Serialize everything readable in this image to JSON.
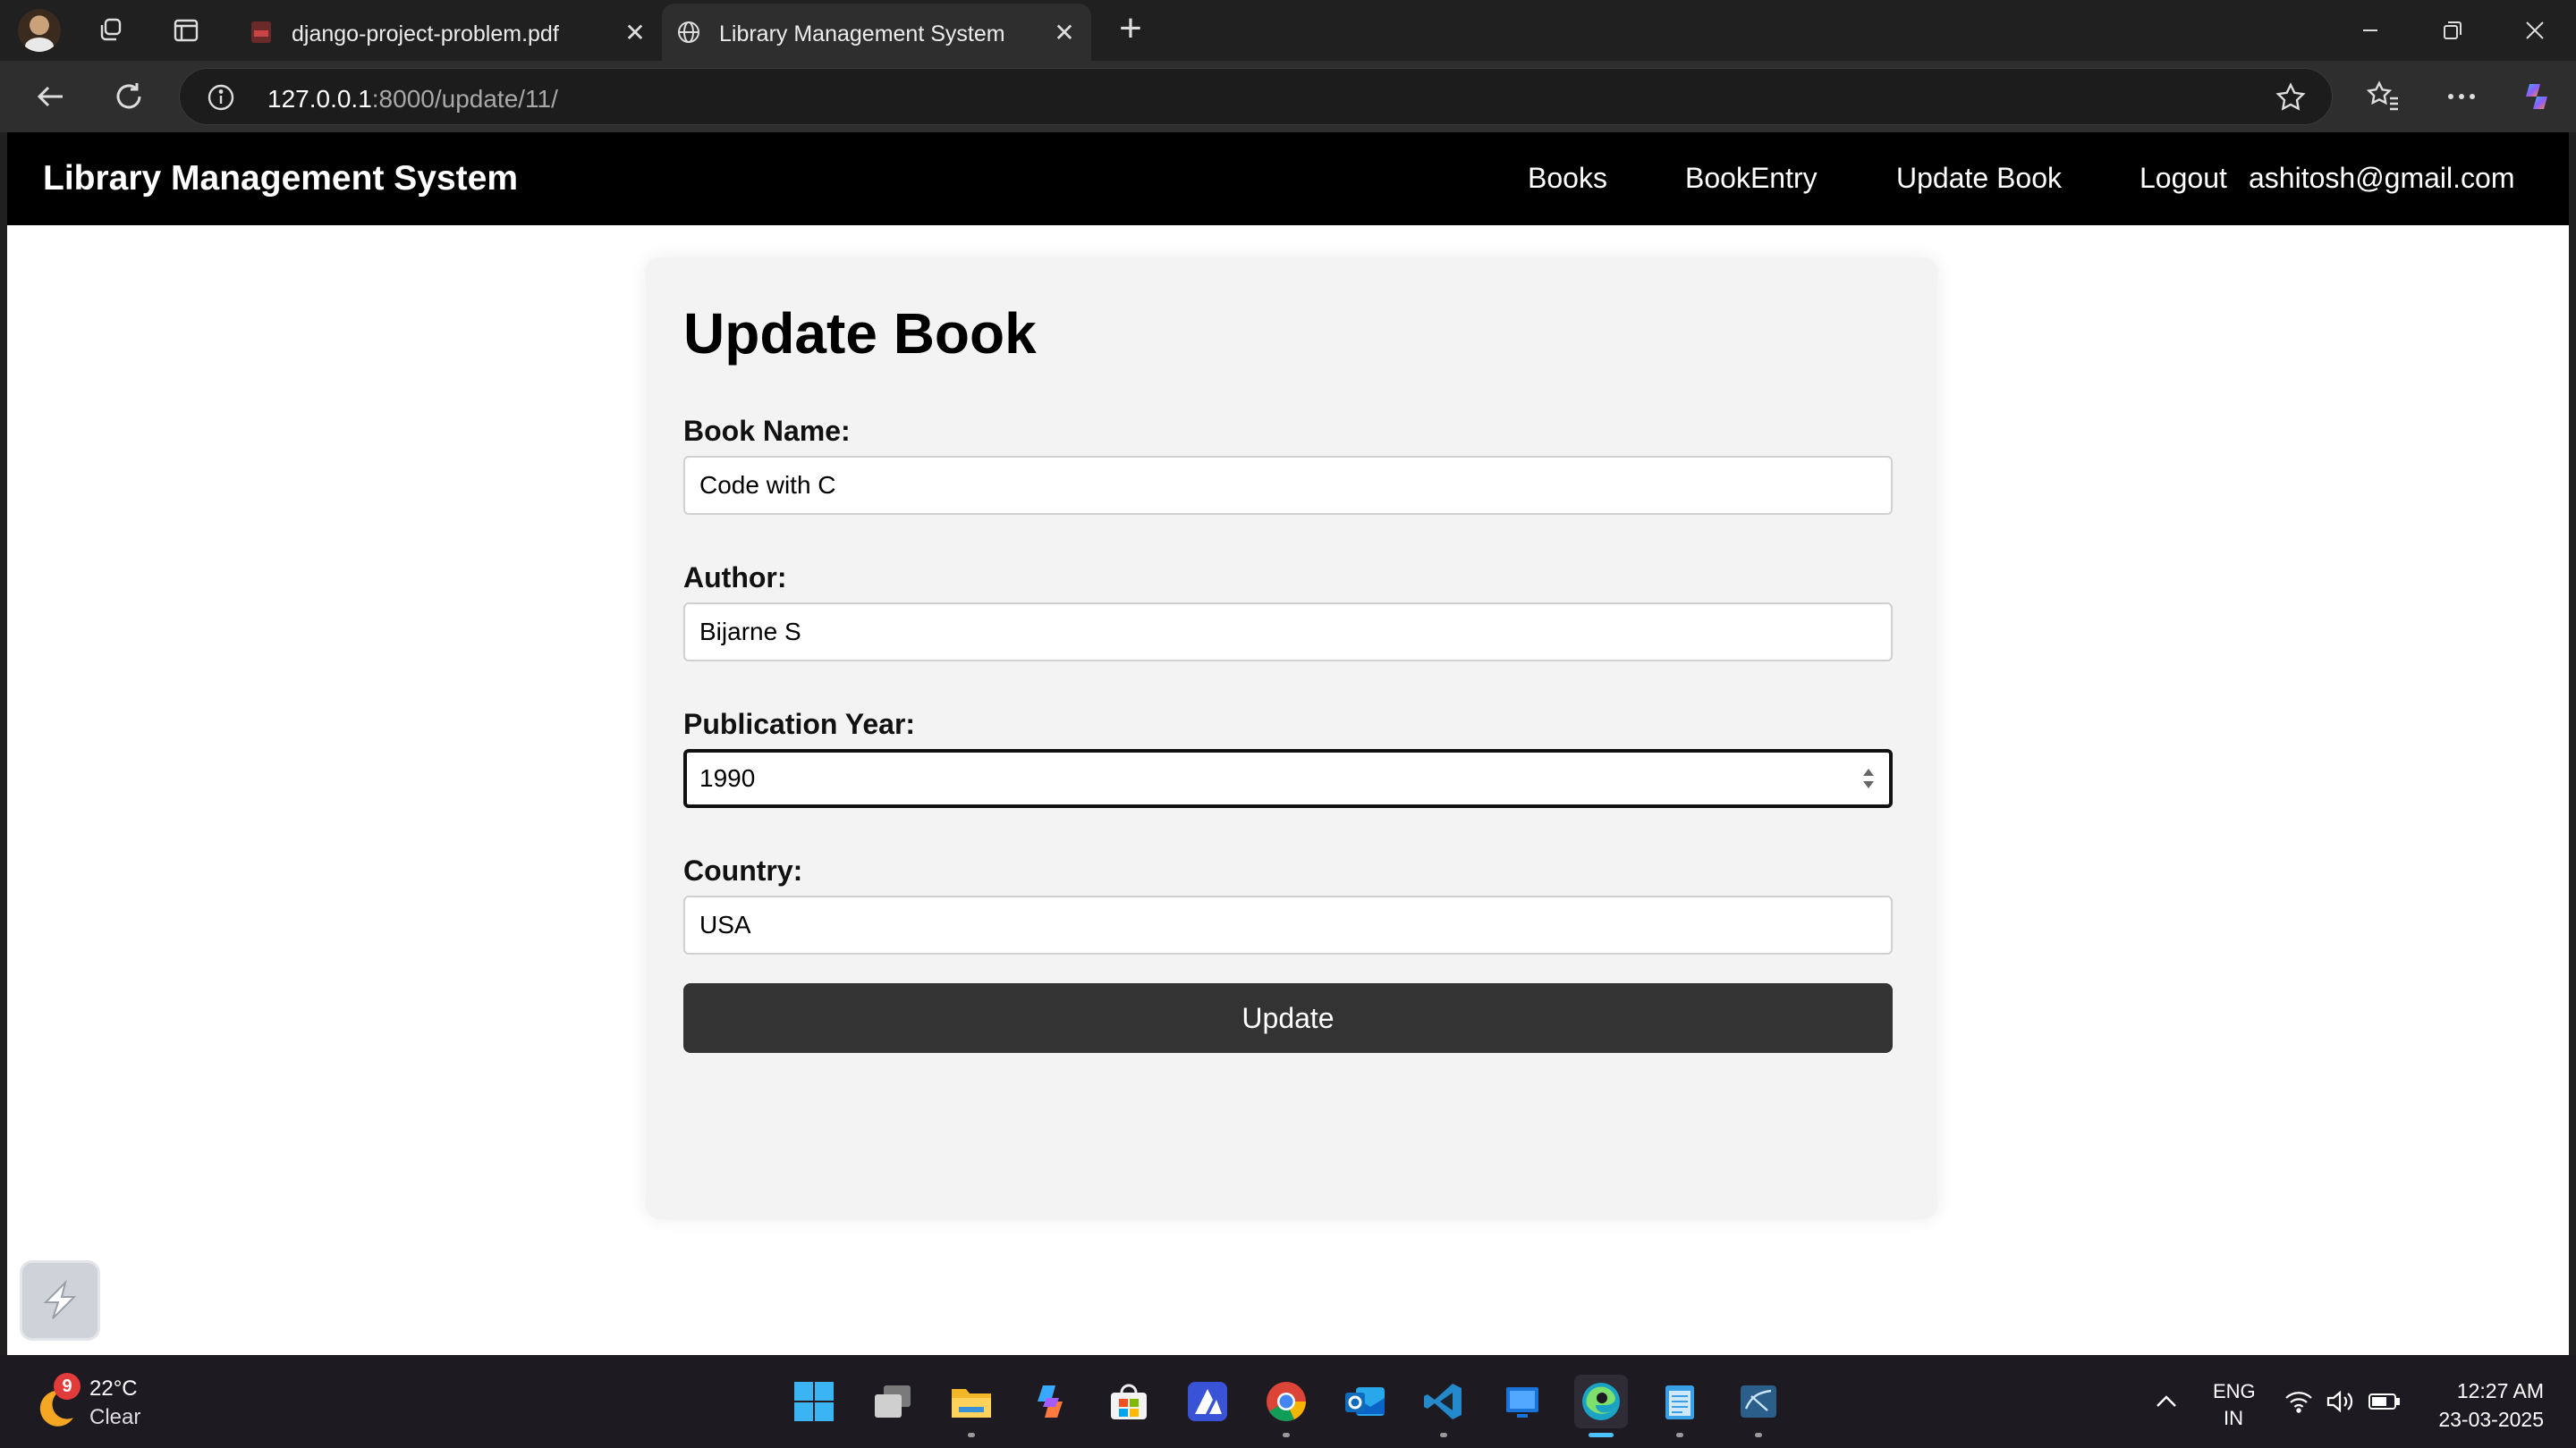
{
  "browser": {
    "tabs": [
      {
        "title": "django-project-problem.pdf",
        "active": false
      },
      {
        "title": "Library Management System",
        "active": true
      }
    ],
    "address": {
      "host": "127.0.0.1",
      "rest": ":8000/update/11/"
    }
  },
  "page": {
    "navbar": {
      "brand": "Library Management System",
      "links": [
        "Books",
        "BookEntry",
        "Update Book",
        "Logout"
      ],
      "user_email": "ashitosh@gmail.com"
    },
    "form": {
      "heading": "Update Book",
      "fields": [
        {
          "label": "Book Name:",
          "value": "Code with C"
        },
        {
          "label": "Author:",
          "value": "Bijarne S"
        },
        {
          "label": "Publication Year:",
          "value": "1990"
        },
        {
          "label": "Country:",
          "value": "USA"
        }
      ],
      "submit_label": "Update"
    }
  },
  "taskbar": {
    "weather": {
      "badge": "9",
      "temp": "22°C",
      "condition": "Clear"
    },
    "language": {
      "line1": "ENG",
      "line2": "IN"
    },
    "clock": {
      "time": "12:27 AM",
      "date": "23-03-2025"
    }
  },
  "colors": {
    "navbar_bg": "#000000",
    "card_bg": "#f3f3f3",
    "button_bg": "#333333",
    "browser_chrome": "#202020",
    "edge_accent": "#4cc2ff"
  }
}
